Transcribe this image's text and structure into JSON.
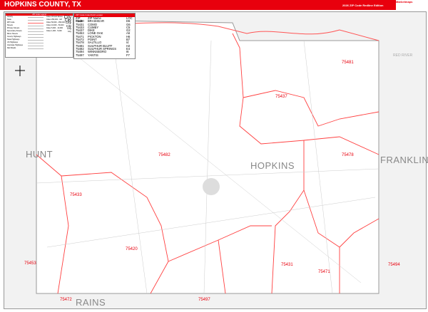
{
  "header": {
    "title": "HOPKINS COUNTY, TX",
    "edition": "2026 ZIP Code Redline Edition",
    "logo": "Marketmaps"
  },
  "legend": {
    "title": "ZIP Code Legend",
    "items": [
      "County",
      "State",
      "ZIP Code",
      "Streets",
      "Primary Streets",
      "Secondary Streets",
      "Minor Streets",
      "County Highways",
      "State Highways",
      "US Highways",
      "Interstate Highways",
      "Rail Roads"
    ],
    "city_sizes": [
      "Cities 1M and Above",
      "Cities 250,000 - 1M",
      "Cities 50,000 - 250,000",
      "Cities 10,000 - 50,000",
      "Cities 5,000 - 10,000",
      "Cities 1,000 - 5,000"
    ],
    "city_sample": "City"
  },
  "zip_index": {
    "title": "ZIP Code Index/Grid Locator",
    "headers": [
      "ZIP Code",
      "ZIP Name",
      "LOC"
    ],
    "rows": [
      [
        "75420",
        "BRASHEAR",
        "D6"
      ],
      [
        "75431",
        "COMO",
        "G6"
      ],
      [
        "75433",
        "CUMBY",
        "C5"
      ],
      [
        "75437",
        "DIKE",
        "G2"
      ],
      [
        "75453",
        "LONE OAK",
        "A6"
      ],
      [
        "75471",
        "PICKTON",
        "H6"
      ],
      [
        "75472",
        "POINT",
        "B7"
      ],
      [
        "75478",
        "SALTILLO",
        "I4"
      ],
      [
        "75481",
        "SULPHUR BLUFF",
        "H2"
      ],
      [
        "75482",
        "SULPHUR SPRINGS",
        "E4"
      ],
      [
        "75494",
        "WINNSBORO",
        "I6"
      ],
      [
        "75497",
        "YANTIS",
        "F7"
      ]
    ]
  },
  "map": {
    "county_label": "HOPKINS",
    "neighbors": [
      "HUNT",
      "FRANKLIN",
      "RAINS"
    ],
    "river": "RED RIVER",
    "zip_labels": [
      "75481",
      "75437",
      "75482",
      "75478",
      "75433",
      "75420",
      "75431",
      "75471",
      "75453",
      "75494",
      "75472",
      "75497"
    ]
  },
  "colors": {
    "accent": "#e8000d",
    "zip_line": "#ff4040"
  }
}
